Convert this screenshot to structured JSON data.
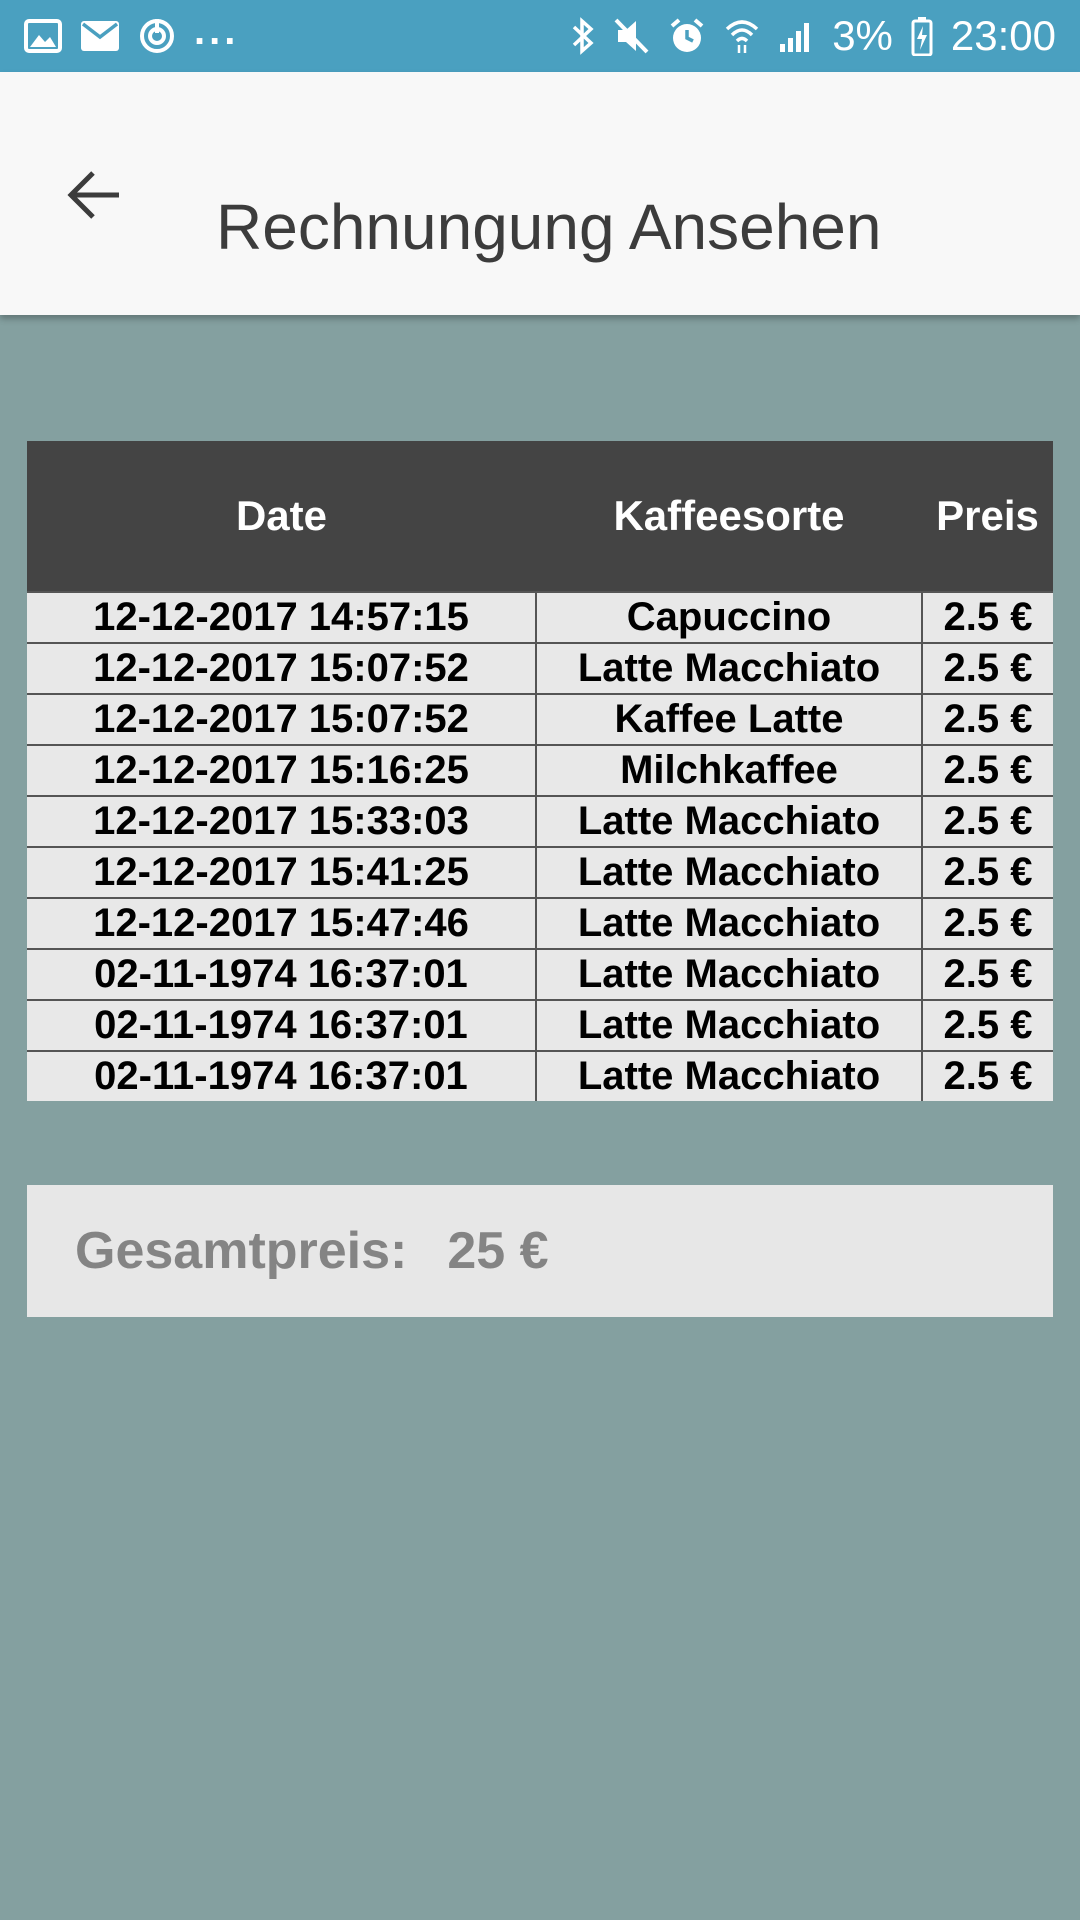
{
  "status_bar": {
    "left_icons": [
      "gallery-icon",
      "mail-icon",
      "sync-icon"
    ],
    "more_indicator": "...",
    "right_icons": [
      "bluetooth-icon",
      "mute-icon",
      "alarm-icon",
      "wifi-icon",
      "signal-icon"
    ],
    "battery_percent": "3%",
    "time": "23:00"
  },
  "app_bar": {
    "back_icon": "arrow-left-icon",
    "title": "Rechnungung Ansehen"
  },
  "table": {
    "headers": [
      "Date",
      "Kaffeesorte",
      "Preis"
    ],
    "rows": [
      [
        "12-12-2017 14:57:15",
        "Capuccino",
        "2.5 €"
      ],
      [
        "12-12-2017 15:07:52",
        "Latte Macchiato",
        "2.5 €"
      ],
      [
        "12-12-2017 15:07:52",
        "Kaffee Latte",
        "2.5 €"
      ],
      [
        "12-12-2017 15:16:25",
        "Milchkaffee",
        "2.5 €"
      ],
      [
        "12-12-2017 15:33:03",
        "Latte Macchiato",
        "2.5 €"
      ],
      [
        "12-12-2017 15:41:25",
        "Latte Macchiato",
        "2.5 €"
      ],
      [
        "12-12-2017 15:47:46",
        "Latte Macchiato",
        "2.5 €"
      ],
      [
        "02-11-1974 16:37:01",
        "Latte Macchiato",
        "2.5 €"
      ],
      [
        "02-11-1974 16:37:01",
        "Latte Macchiato",
        "2.5 €"
      ],
      [
        "02-11-1974 16:37:01",
        "Latte Macchiato",
        "2.5 €"
      ]
    ]
  },
  "total": {
    "label": "Gesamtpreis:",
    "value": "25 €"
  },
  "colors": {
    "status_bar": "#4aa0c0",
    "app_bar": "#f8f8f8",
    "background": "#84a0a0",
    "table_header": "#444444",
    "table_cell": "#e8e8e8",
    "total_text": "#848484"
  }
}
